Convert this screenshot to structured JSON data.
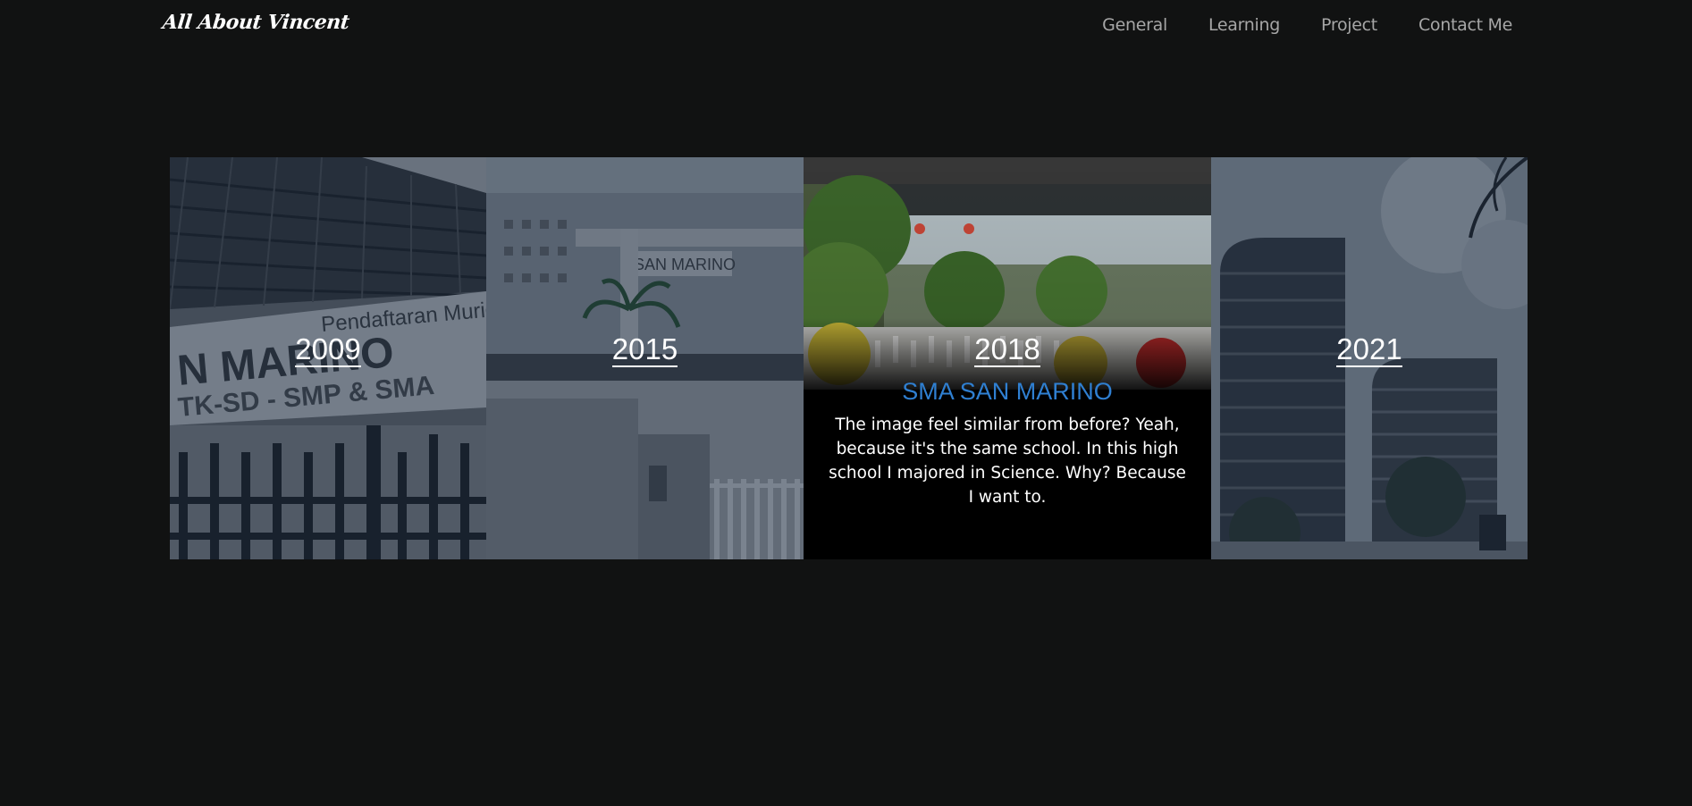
{
  "header": {
    "brand": "All About Vincent",
    "nav": [
      {
        "label": "General"
      },
      {
        "label": "Learning"
      },
      {
        "label": "Project"
      },
      {
        "label": "Contact Me"
      }
    ]
  },
  "timeline": {
    "panels": [
      {
        "year": "2009"
      },
      {
        "year": "2015"
      },
      {
        "year": "2018",
        "title": "SMA SAN MARINO",
        "description": "The image feel similar from before? Yeah, because it's the same school. In this high school I majored in Science. Why? Because I want to."
      },
      {
        "year": "2021"
      }
    ],
    "title_color": "#2f7fd1"
  }
}
